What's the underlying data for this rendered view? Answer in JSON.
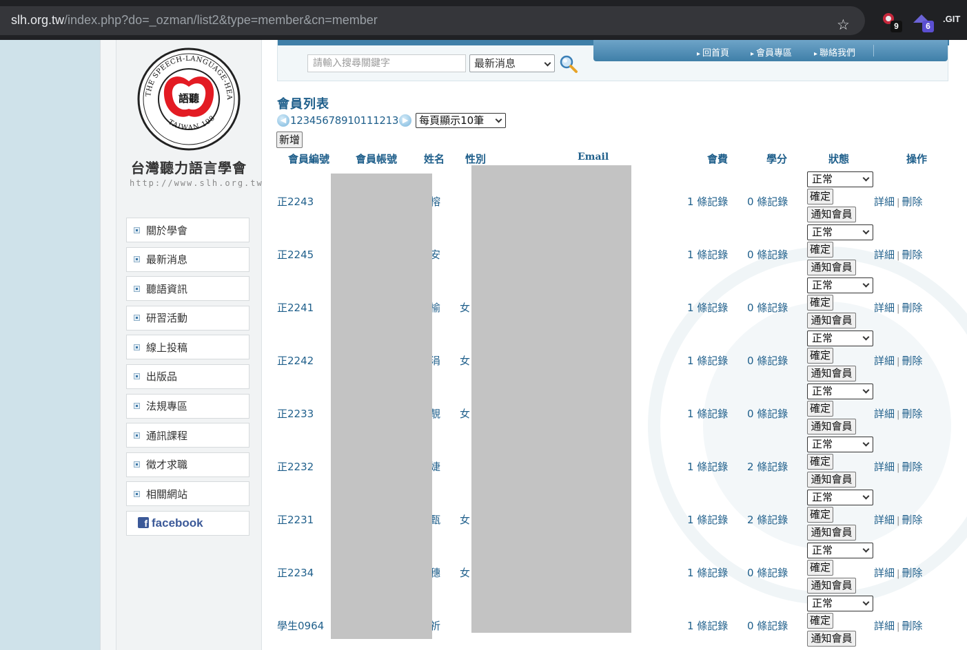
{
  "browser": {
    "url_host": "slh.org.tw",
    "url_path": "/index.php?do=_ozman/list2&type=member&cn=member",
    "ext_badge_1": "9",
    "ext_badge_2": "6",
    "ext_label_3": ".GIT"
  },
  "sidebar": {
    "org_name": "台灣聽力語言學會",
    "org_url": "http://www.slh.org.tw",
    "logo_text_ring": "THE SPEECH-LANGUAGE-HEARING ASSOCIATION",
    "logo_text_bottom": "TAIWAN 1986",
    "logo_text_center": "語聽",
    "items": [
      {
        "label": "關於學會"
      },
      {
        "label": "最新消息"
      },
      {
        "label": "聽語資訊"
      },
      {
        "label": "研習活動"
      },
      {
        "label": "線上投稿"
      },
      {
        "label": "出版品"
      },
      {
        "label": "法規專區"
      },
      {
        "label": "通訊課程"
      },
      {
        "label": "徵才求職"
      },
      {
        "label": "相關網站"
      }
    ],
    "facebook_label": "facebook"
  },
  "topnav": {
    "home": "回首頁",
    "member": "會員專區",
    "contact": "聯絡我們"
  },
  "search": {
    "placeholder": "請輸入搜尋關鍵字",
    "category": "最新消息"
  },
  "list": {
    "title": "會員列表",
    "pages": "12345678910111213",
    "per_page": "每頁顯示10筆",
    "add_label": "新增",
    "columns": {
      "id": "會員編號",
      "account": "會員帳號",
      "name": "姓名",
      "gender": "性別",
      "email": "Email",
      "fee": "會費",
      "credits": "學分",
      "status": "狀態",
      "actions": "操作"
    },
    "rows": [
      {
        "id": "正2243",
        "name": "榕",
        "gender": "",
        "fee": "1 條記錄",
        "credits": "0 條記錄",
        "status": "正常"
      },
      {
        "id": "正2245",
        "name": "安",
        "gender": "",
        "fee": "1 條記錄",
        "credits": "0 條記錄",
        "status": "正常"
      },
      {
        "id": "正2241",
        "name": "榆",
        "gender": "女",
        "fee": "1 條記錄",
        "credits": "0 條記錄",
        "status": "正常"
      },
      {
        "id": "正2242",
        "name": "涓",
        "gender": "女",
        "fee": "1 條記錄",
        "credits": "0 條記錄",
        "status": "正常"
      },
      {
        "id": "正2233",
        "name": "靚",
        "gender": "女",
        "fee": "1 條記錄",
        "credits": "0 條記錄",
        "status": "正常"
      },
      {
        "id": "正2232",
        "name": "婕",
        "gender": "",
        "fee": "1 條記錄",
        "credits": "2 條記錄",
        "status": "正常"
      },
      {
        "id": "正2231",
        "name": "甄",
        "gender": "女",
        "fee": "1 條記錄",
        "credits": "2 條記錄",
        "status": "正常"
      },
      {
        "id": "正2234",
        "name": "穗",
        "gender": "女",
        "fee": "1 條記錄",
        "credits": "0 條記錄",
        "status": "正常"
      },
      {
        "id": "學生0964",
        "name": "祈",
        "gender": "",
        "fee": "1 條記錄",
        "credits": "0 條記錄",
        "status": "正常"
      }
    ],
    "confirm_label": "確定",
    "notify_label": "通知會員",
    "detail_label": "詳細",
    "delete_label": "刪除"
  }
}
